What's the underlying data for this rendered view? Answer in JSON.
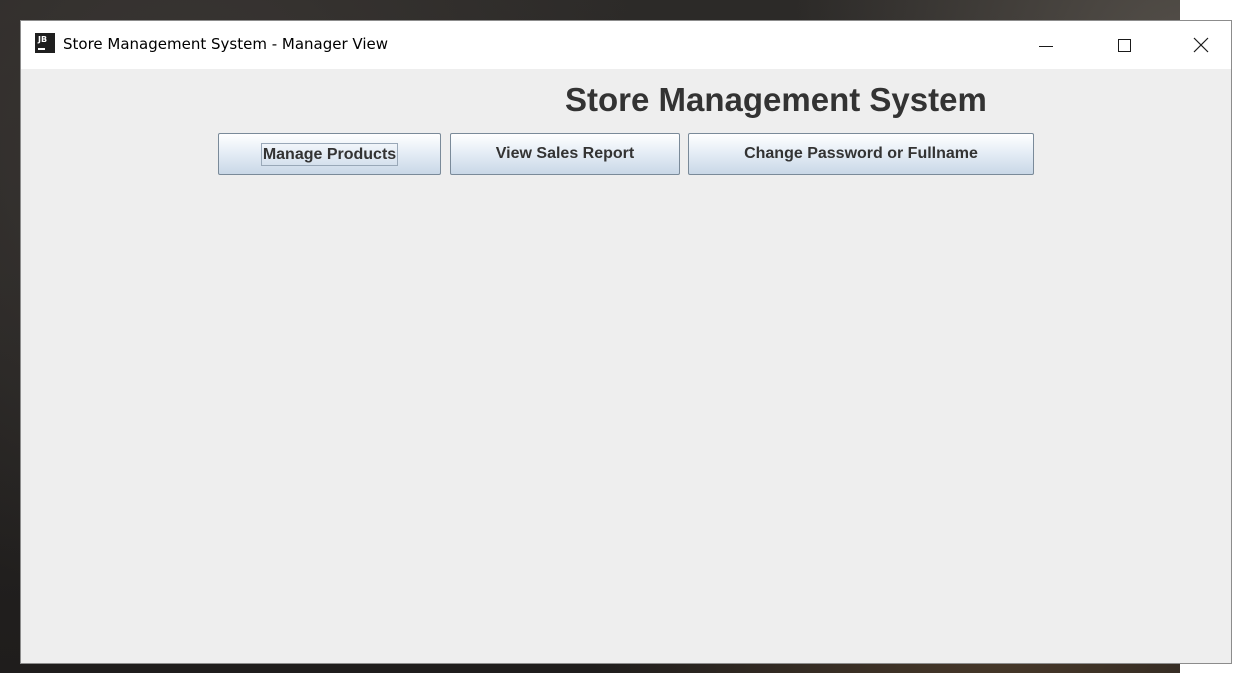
{
  "window": {
    "title": "Store Management System - Manager View",
    "app_icon_text": "JB"
  },
  "main": {
    "heading": "Store Management System",
    "buttons": [
      {
        "label": "Manage Products",
        "focused": true
      },
      {
        "label": "View Sales Report",
        "focused": false
      },
      {
        "label": "Change Password or Fullname",
        "focused": false
      }
    ]
  },
  "icons": {
    "minimize": "minimize-icon",
    "maximize": "maximize-icon",
    "close": "close-icon"
  }
}
